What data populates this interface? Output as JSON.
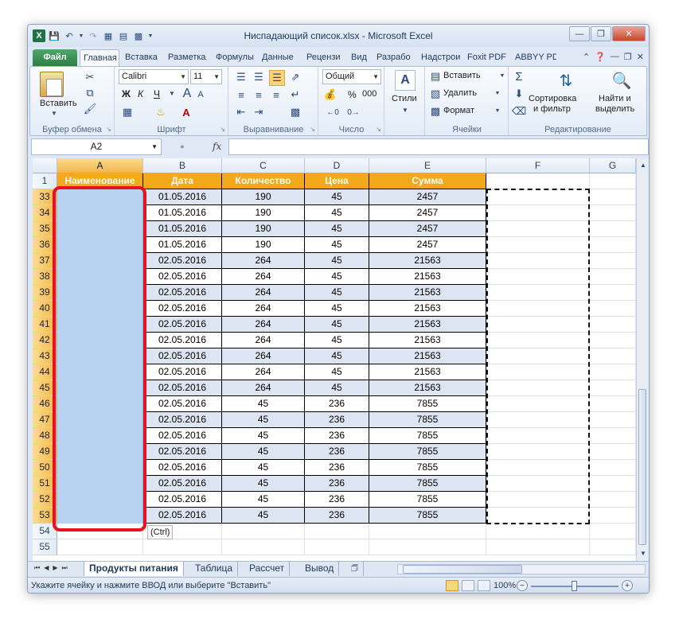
{
  "window": {
    "title": "Ниспадающий список.xlsx - Microsoft Excel",
    "app_icon": "X"
  },
  "ribbon_tabs": [
    "Файл",
    "Главная",
    "Вставка",
    "Разметка",
    "Формулы",
    "Данные",
    "Рецензи",
    "Вид",
    "Разрабо",
    "Надстрои",
    "Foxit PDF",
    "ABBYY PD"
  ],
  "ribbon": {
    "clipboard": {
      "paste": "Вставить",
      "label": "Буфер обмена"
    },
    "font": {
      "name": "Calibri",
      "size": "11",
      "bold": "Ж",
      "italic": "К",
      "underline": "Ч",
      "label": "Шрифт"
    },
    "alignment": {
      "label": "Выравнивание"
    },
    "number": {
      "format": "Общий",
      "label": "Число",
      "percent": "%",
      "thousands": "000"
    },
    "styles": {
      "label": "Стили"
    },
    "cells": {
      "insert": "Вставить",
      "delete": "Удалить",
      "format": "Формат",
      "label": "Ячейки"
    },
    "editing": {
      "sort1": "Сортировка",
      "sort2": "и фильтр",
      "find1": "Найти и",
      "find2": "выделить",
      "label": "Редактирование"
    }
  },
  "formula_bar": {
    "name_box": "A2",
    "fx": "fx",
    "value": ""
  },
  "columns": [
    "A",
    "B",
    "C",
    "D",
    "E",
    "F",
    "G"
  ],
  "header_row": {
    "row": "1",
    "cells": [
      "Наименование",
      "Дата",
      "Количество",
      "Цена",
      "Сумма"
    ]
  },
  "rows": [
    {
      "n": "33",
      "b": "01.05.2016",
      "c": "190",
      "d": "45",
      "e": "2457"
    },
    {
      "n": "34",
      "b": "01.05.2016",
      "c": "190",
      "d": "45",
      "e": "2457"
    },
    {
      "n": "35",
      "b": "01.05.2016",
      "c": "190",
      "d": "45",
      "e": "2457"
    },
    {
      "n": "36",
      "b": "01.05.2016",
      "c": "190",
      "d": "45",
      "e": "2457"
    },
    {
      "n": "37",
      "b": "02.05.2016",
      "c": "264",
      "d": "45",
      "e": "21563"
    },
    {
      "n": "38",
      "b": "02.05.2016",
      "c": "264",
      "d": "45",
      "e": "21563"
    },
    {
      "n": "39",
      "b": "02.05.2016",
      "c": "264",
      "d": "45",
      "e": "21563"
    },
    {
      "n": "40",
      "b": "02.05.2016",
      "c": "264",
      "d": "45",
      "e": "21563"
    },
    {
      "n": "41",
      "b": "02.05.2016",
      "c": "264",
      "d": "45",
      "e": "21563"
    },
    {
      "n": "42",
      "b": "02.05.2016",
      "c": "264",
      "d": "45",
      "e": "21563"
    },
    {
      "n": "43",
      "b": "02.05.2016",
      "c": "264",
      "d": "45",
      "e": "21563"
    },
    {
      "n": "44",
      "b": "02.05.2016",
      "c": "264",
      "d": "45",
      "e": "21563"
    },
    {
      "n": "45",
      "b": "02.05.2016",
      "c": "264",
      "d": "45",
      "e": "21563"
    },
    {
      "n": "46",
      "b": "02.05.2016",
      "c": "45",
      "d": "236",
      "e": "7855"
    },
    {
      "n": "47",
      "b": "02.05.2016",
      "c": "45",
      "d": "236",
      "e": "7855"
    },
    {
      "n": "48",
      "b": "02.05.2016",
      "c": "45",
      "d": "236",
      "e": "7855"
    },
    {
      "n": "49",
      "b": "02.05.2016",
      "c": "45",
      "d": "236",
      "e": "7855"
    },
    {
      "n": "50",
      "b": "02.05.2016",
      "c": "45",
      "d": "236",
      "e": "7855"
    },
    {
      "n": "51",
      "b": "02.05.2016",
      "c": "45",
      "d": "236",
      "e": "7855"
    },
    {
      "n": "52",
      "b": "02.05.2016",
      "c": "45",
      "d": "236",
      "e": "7855"
    },
    {
      "n": "53",
      "b": "02.05.2016",
      "c": "45",
      "d": "236",
      "e": "7855"
    }
  ],
  "empty_rows": [
    "54",
    "55"
  ],
  "paste_options": "(Ctrl)",
  "sheets": [
    "Продукты питания",
    "Таблица",
    "Рассчет",
    "Вывод"
  ],
  "active_sheet": "Продукты питания",
  "status": {
    "message": "Укажите ячейку и нажмите ВВОД или выберите \"Вставить\"",
    "zoom": "100%"
  },
  "colors": {
    "header_fill": "#f2a91a",
    "band_fill": "#dce5f1",
    "selection": "#b8d3f2",
    "highlight_box": "#e81123"
  }
}
